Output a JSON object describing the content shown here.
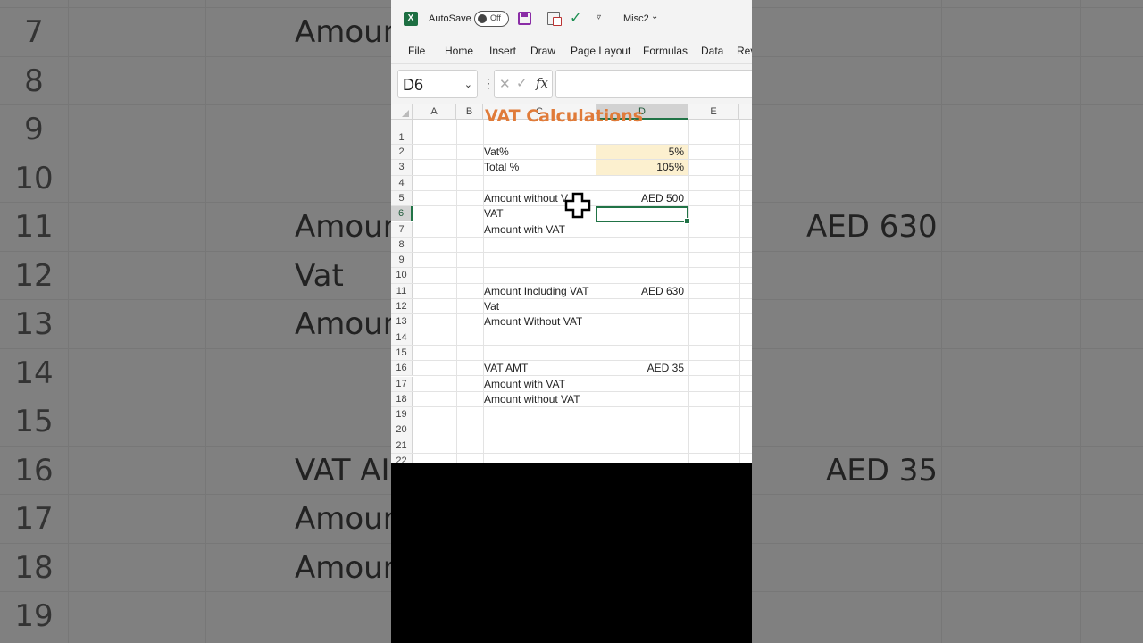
{
  "window": {
    "app_logo": "X",
    "autosave_label": "AutoSave",
    "autosave_state": "Off",
    "file_name": "Misc2"
  },
  "menu": [
    "File",
    "Home",
    "Insert",
    "Draw",
    "Page Layout",
    "Formulas",
    "Data",
    "Rev"
  ],
  "formula_bar": {
    "name_box": "D6",
    "formula": ""
  },
  "columns": [
    "A",
    "B",
    "C",
    "D",
    "E"
  ],
  "selected_column": "D",
  "selected_row": "6",
  "sheet": {
    "title": "VAT Calculations",
    "rows": [
      {
        "num": "1",
        "c": "",
        "d": ""
      },
      {
        "num": "2",
        "c": "Vat%",
        "d": "5%"
      },
      {
        "num": "3",
        "c": "Total %",
        "d": "105%"
      },
      {
        "num": "4",
        "c": "",
        "d": ""
      },
      {
        "num": "5",
        "c": "Amount without V",
        "d": "AED 500"
      },
      {
        "num": "6",
        "c": "VAT",
        "d": ""
      },
      {
        "num": "7",
        "c": "Amount with VAT",
        "d": ""
      },
      {
        "num": "8",
        "c": "",
        "d": ""
      },
      {
        "num": "9",
        "c": "",
        "d": ""
      },
      {
        "num": "10",
        "c": "",
        "d": ""
      },
      {
        "num": "11",
        "c": "Amount Including VAT",
        "d": "AED 630"
      },
      {
        "num": "12",
        "c": "Vat",
        "d": ""
      },
      {
        "num": "13",
        "c": "Amount Without VAT",
        "d": ""
      },
      {
        "num": "14",
        "c": "",
        "d": ""
      },
      {
        "num": "15",
        "c": "",
        "d": ""
      },
      {
        "num": "16",
        "c": "VAT AMT",
        "d": "AED 35"
      },
      {
        "num": "17",
        "c": "Amount with VAT",
        "d": ""
      },
      {
        "num": "18",
        "c": "Amount without VAT",
        "d": ""
      },
      {
        "num": "19",
        "c": "",
        "d": ""
      },
      {
        "num": "20",
        "c": "",
        "d": ""
      },
      {
        "num": "21",
        "c": "",
        "d": ""
      },
      {
        "num": "22",
        "c": "",
        "d": ""
      }
    ]
  },
  "background": {
    "row_numbers": [
      "7",
      "8",
      "9",
      "10",
      "11",
      "12",
      "13",
      "14",
      "15",
      "16",
      "17",
      "18",
      "19"
    ],
    "texts": {
      "r7": "Amoun",
      "r11": "Amoun",
      "r11_value": "AED 630",
      "r12": "Vat",
      "r13": "Amoun",
      "r16": "VAT AI",
      "r16_value": "AED 35",
      "r17": "Amoun",
      "r18": "Amoun"
    }
  },
  "colors": {
    "accent": "#217346",
    "title": "#e07b39",
    "input_fill": "#fcf0cf"
  },
  "icons": [
    "excel-logo-icon",
    "save-icon",
    "touch-mode-icon",
    "check-icon",
    "customize-toolbar-icon",
    "chevron-down-icon",
    "cancel-icon",
    "enter-icon",
    "function-icon",
    "cross-cursor-icon"
  ]
}
